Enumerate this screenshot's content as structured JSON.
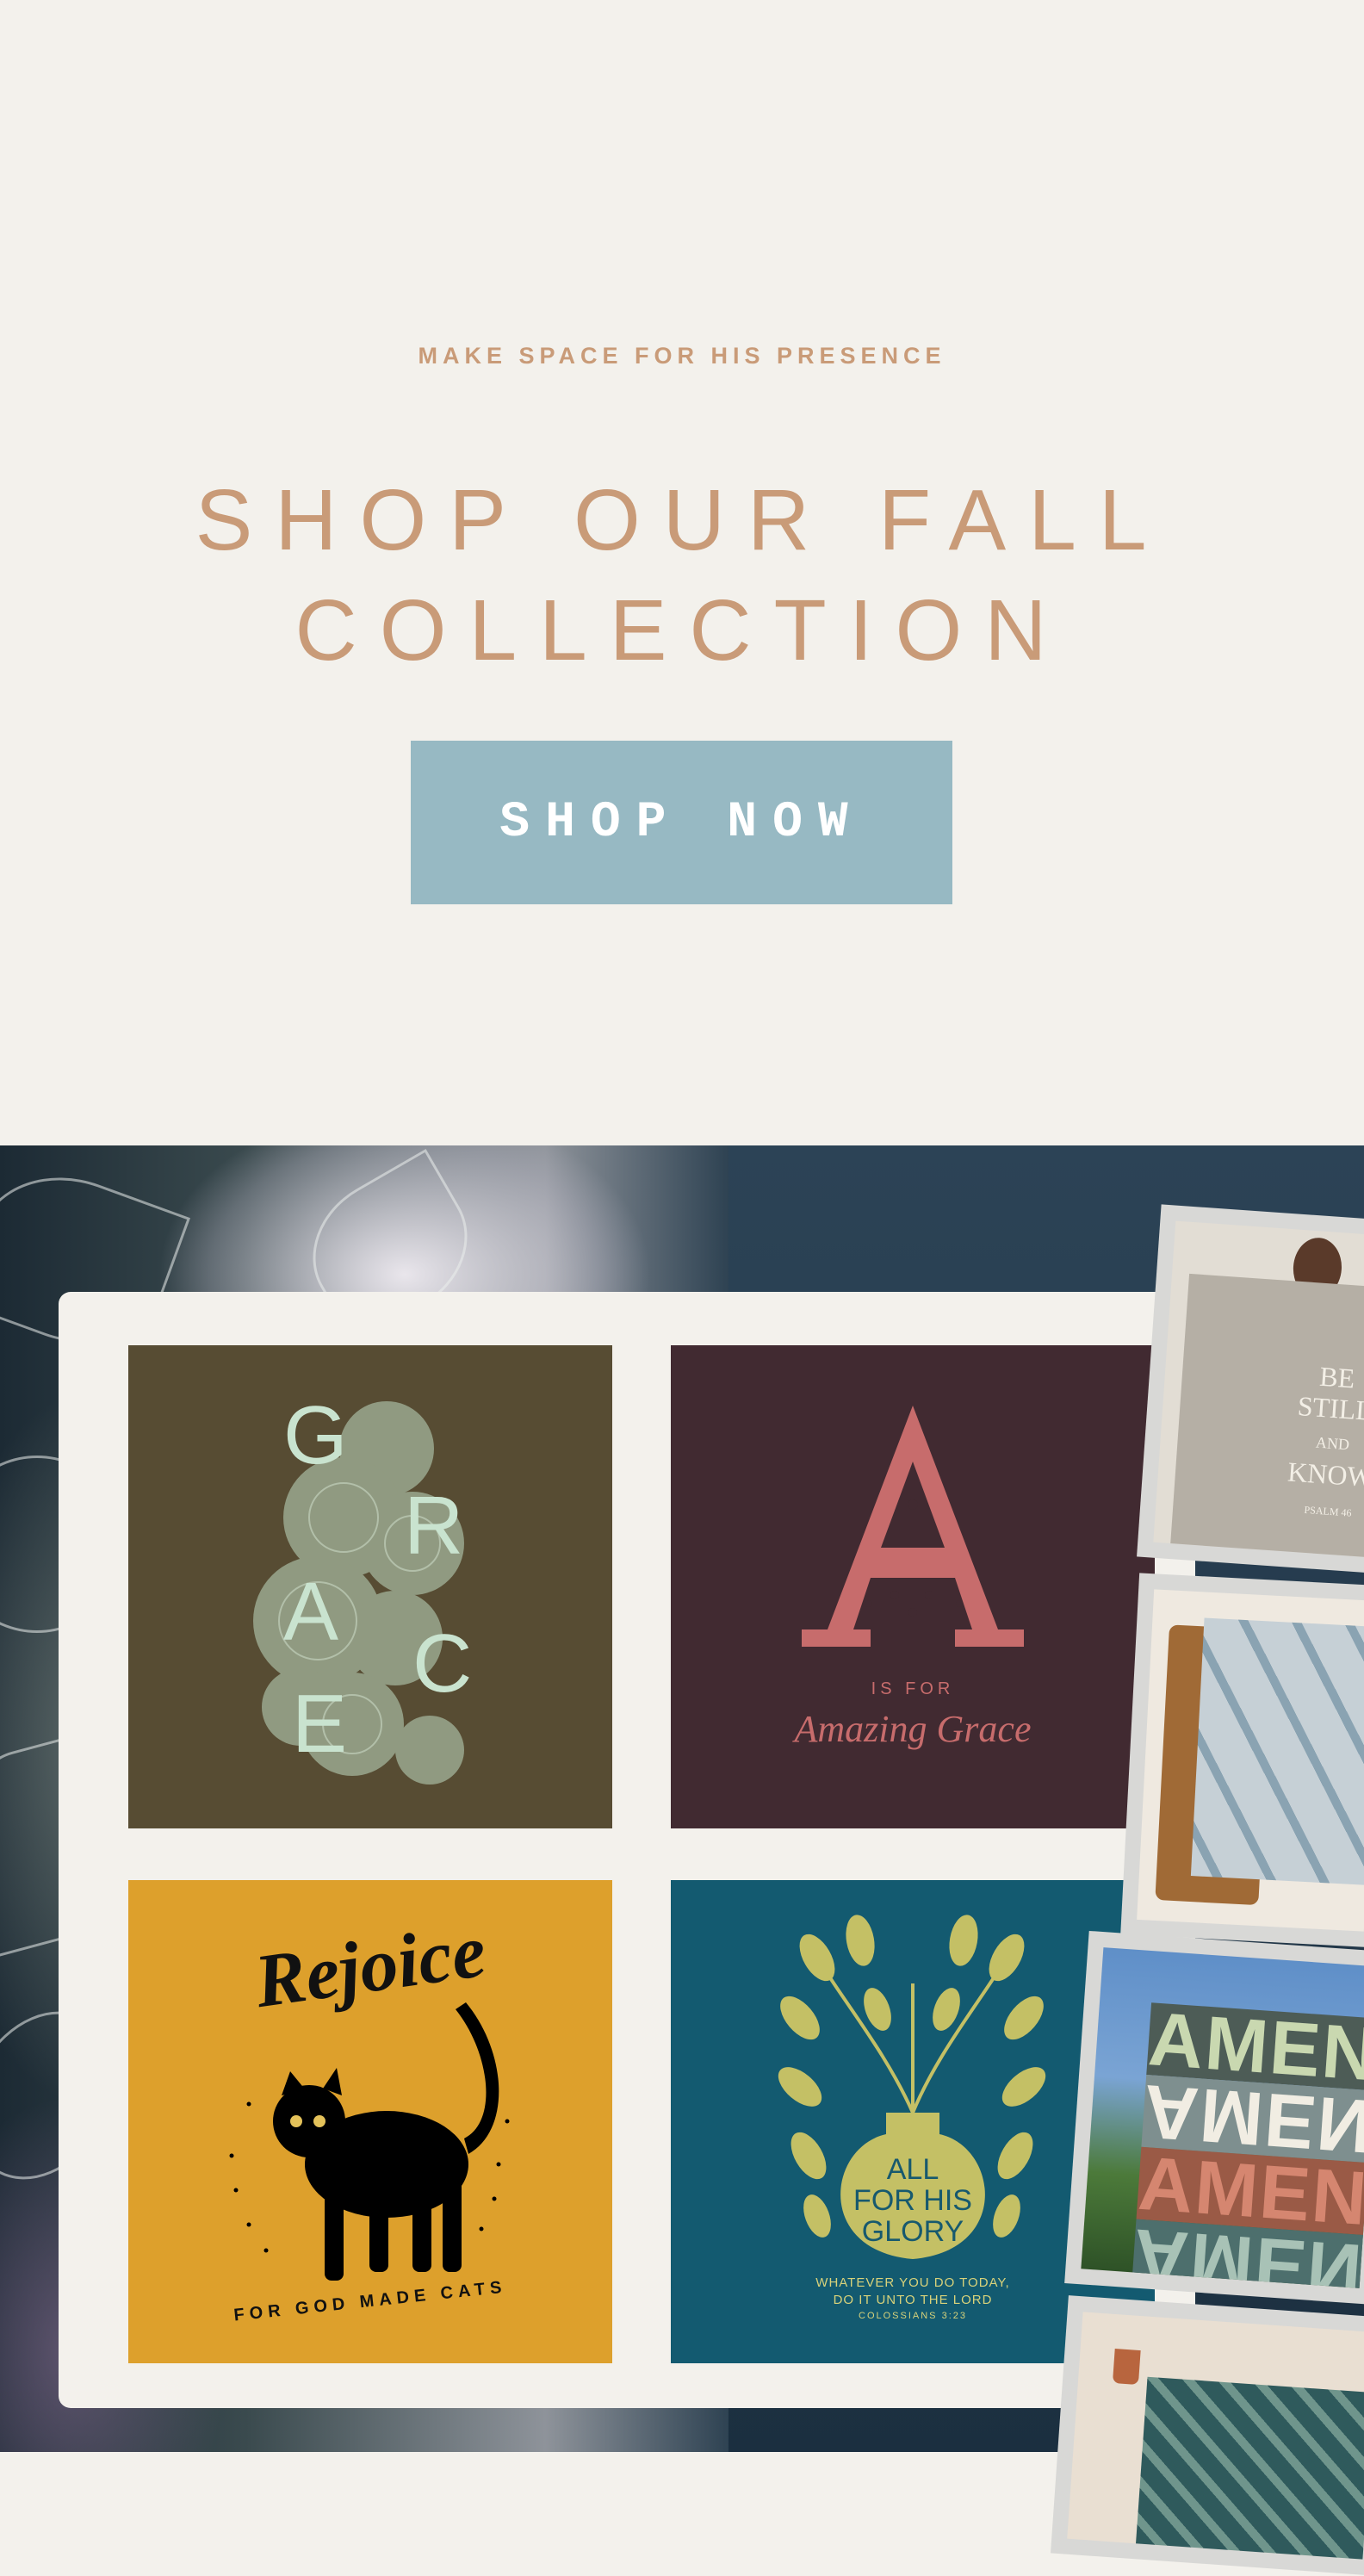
{
  "hero": {
    "eyebrow": "MAKE SPACE FOR HIS PRESENCE",
    "headline_line1": "SHOP OUR FALL",
    "headline_line2": "COLLECTION",
    "cta_label": "SHOP NOW"
  },
  "tiles": {
    "grace": {
      "letters": [
        "G",
        "R",
        "A",
        "C",
        "E"
      ]
    },
    "amazing": {
      "big_letter": "A",
      "caption": "IS FOR",
      "script": "Amazing Grace"
    },
    "rejoice": {
      "title": "Rejoice",
      "arc_text": "FOR GOD MADE CATS"
    },
    "glory": {
      "vase_line1": "ALL",
      "vase_line2": "FOR HIS",
      "vase_line3": "GLORY",
      "verse_line1": "WHATEVER YOU DO TODAY,",
      "verse_line2": "DO IT UNTO THE LORD",
      "verse_ref": "COLOSSIANS 3:23"
    }
  },
  "product_photos": {
    "blanket1_lines": [
      "BE",
      "STILL",
      "AND",
      "KNOW"
    ],
    "blanket1_ref": "PSALM 46",
    "amen_word": "AMEN"
  },
  "colors": {
    "background": "#f3f1ec",
    "accent_tan": "#c99b78",
    "button_blue": "#97b9c3",
    "tile_olive": "#574c33",
    "tile_plum": "#412a31",
    "tile_mustard": "#dda02c",
    "tile_teal": "#135a70"
  }
}
